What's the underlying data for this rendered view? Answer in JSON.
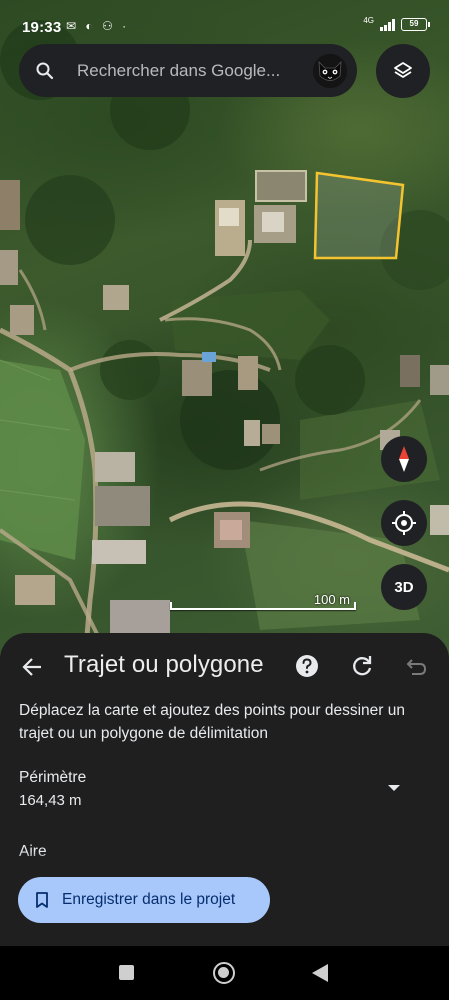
{
  "status_bar": {
    "time": "19:33",
    "notifications": "✉ ◐ ⚇ ·",
    "network": "4G",
    "battery": "59"
  },
  "search": {
    "placeholder": "Rechercher dans Google..."
  },
  "map": {
    "scale_label": "100 m",
    "three_d_label": "3D",
    "colors": {
      "polygon_outline": "#f4c430",
      "road": "#c8b894"
    }
  },
  "panel": {
    "title": "Trajet ou polygone",
    "description": "Déplacez la carte et ajoutez des points pour dessiner un trajet ou un polygone de délimitation",
    "perimeter_label": "Périmètre",
    "perimeter_value": "164,43 m",
    "area_label": "Aire",
    "save_button": "Enregistrer dans le projet"
  },
  "colors": {
    "panel_bg": "#1f1f1f",
    "save_button_bg": "#a8c7fa",
    "save_button_text": "#062e6f"
  }
}
